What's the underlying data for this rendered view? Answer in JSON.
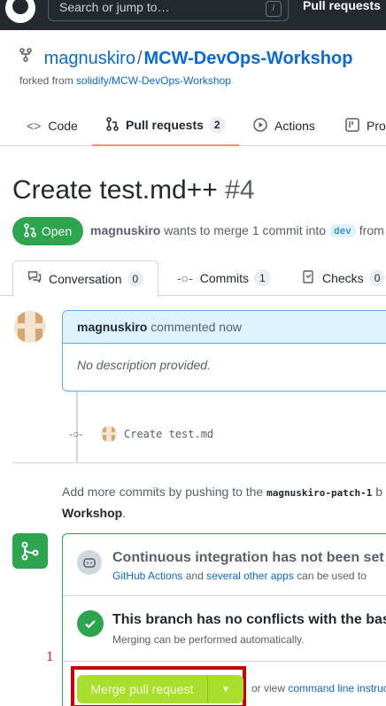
{
  "header": {
    "search_placeholder": "Search or jump to…",
    "search_shortcut": "/",
    "pull_requests_link": "Pull requests"
  },
  "repo": {
    "owner": "magnuskiro",
    "separator": "/",
    "name": "MCW-DevOps-Workshop",
    "forked_prefix": "forked from",
    "forked_from": "solidify/MCW-DevOps-Workshop"
  },
  "repo_nav": {
    "tabs": [
      {
        "label": "Code",
        "icon": "code-icon"
      },
      {
        "label": "Pull requests",
        "icon": "pull-request-icon",
        "count": "2"
      },
      {
        "label": "Actions",
        "icon": "play-icon"
      },
      {
        "label": "Pro",
        "icon": "project-icon"
      }
    ]
  },
  "pr": {
    "title": "Create test.md++",
    "number": "#4",
    "state": "Open",
    "author": "magnuskiro",
    "meta_text": "wants to merge 1 commit into",
    "base_branch": "dev",
    "meta_tail": "from"
  },
  "pr_tabs": [
    {
      "label": "Conversation",
      "count": "0"
    },
    {
      "label": "Commits",
      "count": "1"
    },
    {
      "label": "Checks",
      "count": "0"
    }
  ],
  "comment": {
    "author": "magnuskiro",
    "action": "commented now",
    "body": "No description provided."
  },
  "commit": {
    "message": "Create test.md"
  },
  "add_more": {
    "prefix": "Add more commits by pushing to the",
    "branch": "magnuskiro-patch-1",
    "tail_char": "b",
    "line2": "Workshop",
    "line2_end": "."
  },
  "merge": {
    "ci_title": "Continuous integration has not been set",
    "ci_link1": "GitHub Actions",
    "ci_and": "and",
    "ci_link2": "several other apps",
    "ci_tail": "can be used to",
    "nc_title": "This branch has no conflicts with the bas",
    "nc_sub": "Merging can be performed automatically.",
    "step_number": "1",
    "button_label": "Merge pull request",
    "or_view": "or view",
    "cmd_link": "command line instruc"
  },
  "colors": {
    "accent": "#0969da",
    "success": "#2da44e",
    "merge_button": "#a8df2c",
    "highlight": "#c40000"
  }
}
